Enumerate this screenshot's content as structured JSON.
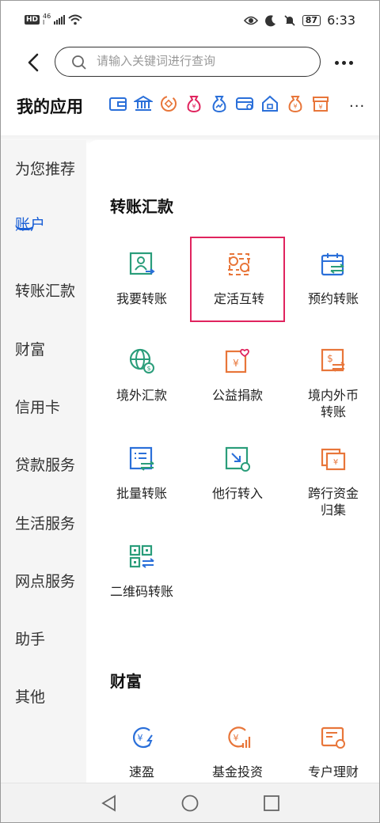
{
  "status_bar": {
    "hd": "HD",
    "net_top": "46",
    "net_bottom": "l",
    "battery": "87",
    "time": "6:33"
  },
  "search": {
    "placeholder": "请输入关键词进行查询"
  },
  "my_apps": {
    "title": "我的应用",
    "more": "...",
    "icons": [
      "wallet-icon",
      "bank-icon",
      "coin-cycle-icon",
      "money-bag-icon",
      "fund-bag-icon",
      "card-icon",
      "home-icon",
      "gold-bag-icon",
      "gift-box-icon"
    ]
  },
  "sidebar": {
    "items": [
      "为您推荐",
      "账户",
      "转账汇款",
      "财富",
      "信用卡",
      "贷款服务",
      "生活服务",
      "网点服务",
      "助手",
      "其他"
    ],
    "active": "账户"
  },
  "sections": [
    {
      "title": "转账汇款",
      "tiles": [
        {
          "label": "我要转账",
          "icon": "transfer-person-icon"
        },
        {
          "label": "定活互转",
          "icon": "fixed-current-transfer-icon"
        },
        {
          "label": "预约转账",
          "icon": "calendar-transfer-icon"
        },
        {
          "label": "境外汇款",
          "icon": "globe-dollar-icon"
        },
        {
          "label": "公益捐款",
          "icon": "charity-heart-icon"
        },
        {
          "label": "境内外币\n转账",
          "icon": "foreign-currency-icon"
        },
        {
          "label": "批量转账",
          "icon": "batch-list-icon"
        },
        {
          "label": "他行转入",
          "icon": "inbound-arrow-icon"
        },
        {
          "label": "跨行资金\n归集",
          "icon": "cross-bank-collect-icon"
        },
        {
          "label": "二维码转账",
          "icon": "qrcode-icon"
        }
      ]
    },
    {
      "title": "财富",
      "tiles": [
        {
          "label": "速盈",
          "icon": "fast-yield-icon"
        },
        {
          "label": "基金投资",
          "icon": "fund-chart-icon"
        },
        {
          "label": "专户理财",
          "icon": "account-card-icon"
        }
      ]
    }
  ],
  "colors": {
    "active_blue": "#1a5fd6",
    "teal": "#2a9d7a",
    "orange": "#e8763a",
    "blue": "#2a6fd9",
    "highlight": "#e0245e"
  }
}
